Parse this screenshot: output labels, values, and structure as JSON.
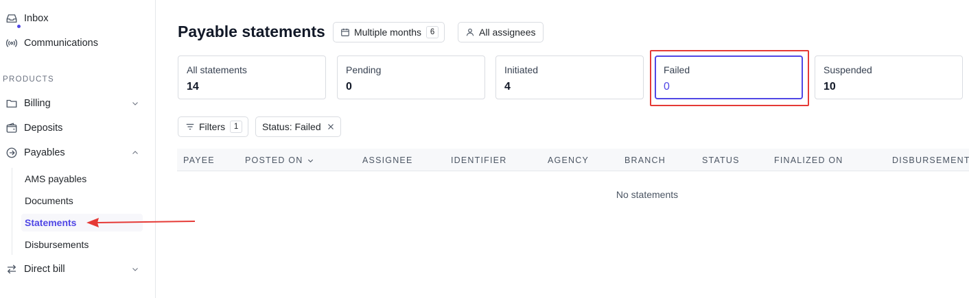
{
  "sidebar": {
    "top_items": [
      {
        "label": "Inbox",
        "icon": "inbox-icon"
      },
      {
        "label": "Communications",
        "icon": "broadcast-icon"
      }
    ],
    "section_label": "PRODUCTS",
    "products": [
      {
        "label": "Billing",
        "icon": "folder-icon",
        "expanded": false
      },
      {
        "label": "Deposits",
        "icon": "wallet-icon"
      },
      {
        "label": "Payables",
        "icon": "arrow-right-circle-icon",
        "expanded": true
      },
      {
        "label": "Direct bill",
        "icon": "swap-icon",
        "expanded": false
      }
    ],
    "payables_sub": [
      {
        "label": "AMS payables"
      },
      {
        "label": "Documents"
      },
      {
        "label": "Statements",
        "active": true
      },
      {
        "label": "Disbursements"
      }
    ]
  },
  "header": {
    "title": "Payable statements",
    "date_filter": {
      "label": "Multiple months",
      "count": "6"
    },
    "assignee_filter": {
      "label": "All assignees"
    }
  },
  "stats": [
    {
      "label": "All statements",
      "value": "14"
    },
    {
      "label": "Pending",
      "value": "0"
    },
    {
      "label": "Initiated",
      "value": "4"
    },
    {
      "label": "Failed",
      "value": "0",
      "selected": true
    },
    {
      "label": "Suspended",
      "value": "10"
    }
  ],
  "filters": {
    "button_label": "Filters",
    "count": "1",
    "active_filter": "Status: Failed"
  },
  "table": {
    "columns": [
      "PAYEE",
      "POSTED ON",
      "ASSIGNEE",
      "IDENTIFIER",
      "AGENCY",
      "BRANCH",
      "STATUS",
      "FINALIZED ON",
      "DISBURSEMENT"
    ],
    "empty_message": "No statements"
  },
  "colors": {
    "accent": "#4f46e5",
    "annotation": "#e53935"
  }
}
